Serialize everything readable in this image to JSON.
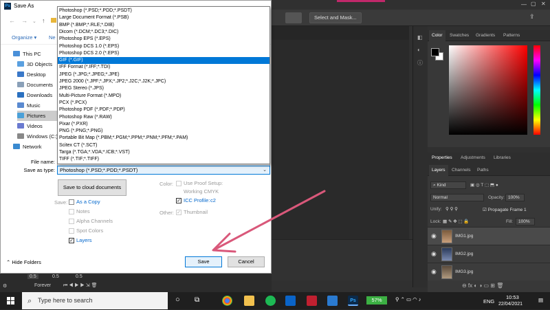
{
  "photoshop": {
    "optbar_button": "Select and Mask...",
    "panels": {
      "color_tabs": [
        "Color",
        "Swatches",
        "Gradients",
        "Patterns"
      ],
      "props_tabs": [
        "Properties",
        "Adjustments",
        "Libraries"
      ],
      "layer_tabs": [
        "Layers",
        "Channels",
        "Paths"
      ],
      "kind": "Kind",
      "blend_mode": "Normal",
      "opacity_label": "Opacity:",
      "opacity_value": "100%",
      "unify_label": "Unify:",
      "propagate_label": "Propagate Frame 1",
      "lock_label": "Lock:",
      "fill_label": "Fill:",
      "fill_value": "100%",
      "layers": [
        "IMG1.jpg",
        "IMG2.jpg",
        "IMG3.jpg"
      ]
    },
    "timeline": {
      "delay1": "0.5",
      "delay2": "0.5",
      "delay3": "0.5",
      "loop": "Forever"
    }
  },
  "dialog": {
    "title": "Save As",
    "organize": "Organize",
    "new_folder": "Ne",
    "tree": [
      {
        "label": "This PC",
        "color": "#4a90d9",
        "cls": "pc"
      },
      {
        "label": "3D Objects",
        "color": "#5aa0e0",
        "cls": "sub"
      },
      {
        "label": "Desktop",
        "color": "#3a78c8",
        "cls": "sub"
      },
      {
        "label": "Documents",
        "color": "#8aa0b8",
        "cls": "sub"
      },
      {
        "label": "Downloads",
        "color": "#2a70c0",
        "cls": "sub"
      },
      {
        "label": "Music",
        "color": "#5a8ad0",
        "cls": "sub"
      },
      {
        "label": "Pictures",
        "color": "#4aa0d8",
        "cls": "sub sel"
      },
      {
        "label": "Videos",
        "color": "#6a7ad0",
        "cls": "sub"
      },
      {
        "label": "Windows (C:)",
        "color": "#888",
        "cls": "sub"
      },
      {
        "label": "Network",
        "color": "#3a8ad0",
        "cls": "pc"
      }
    ],
    "file_types": [
      "Photoshop (*.PSD;*.PDD;*.PSDT)",
      "Large Document Format (*.PSB)",
      "BMP (*.BMP;*.RLE;*.DIB)",
      "Dicom (*.DCM;*.DC3;*.DIC)",
      "Photoshop EPS (*.EPS)",
      "Photoshop DCS 1.0 (*.EPS)",
      "Photoshop DCS 2.0 (*.EPS)",
      "GIF (*.GIF)",
      "IFF Format (*.IFF;*.TDI)",
      "JPEG (*.JPG;*.JPEG;*.JPE)",
      "JPEG 2000 (*.JPF;*.JPX;*.JP2;*.J2C;*.J2K;*.JPC)",
      "JPEG Stereo (*.JPS)",
      "Multi-Picture Format (*.MPO)",
      "PCX (*.PCX)",
      "Photoshop PDF (*.PDF;*.PDP)",
      "Photoshop Raw (*.RAW)",
      "Pixar (*.PXR)",
      "PNG (*.PNG;*.PNG)",
      "Portable Bit Map (*.PBM;*.PGM;*.PPM;*.PNM;*.PFM;*.PAM)",
      "Scitex CT (*.SCT)",
      "Targa (*.TGA;*.VDA;*.ICB;*.VST)",
      "TIFF (*.TIF;*.TIFF)"
    ],
    "selected_index": 7,
    "file_name_label": "File name:",
    "save_as_type_label": "Save as type:",
    "save_as_type_value": "Photoshop (*.PSD;*.PDD;*.PSDT)",
    "cloud_button": "Save to cloud documents",
    "save_label": "Save:",
    "as_copy": "As a Copy",
    "notes": "Notes",
    "alpha_channels": "Alpha Channels",
    "spot_colors": "Spot Colors",
    "layers": "Layers",
    "color_label": "Color:",
    "use_proof": "Use Proof Setup:",
    "working_cmyk": "Working CMYK",
    "icc_profile": "ICC Profile:",
    "icc_value": "c2",
    "other_label": "Other:",
    "thumbnail": "Thumbnail",
    "hide_folders": "Hide Folders",
    "save_button": "Save",
    "cancel_button": "Cancel"
  },
  "taskbar": {
    "search_placeholder": "Type here to search",
    "battery": "57%",
    "language": "ENG",
    "time": "10:53",
    "date": "22/04/2021"
  },
  "colors": {
    "accent": "#0078d7",
    "arrow": "#d9587a",
    "ps_bg": "#303030"
  }
}
